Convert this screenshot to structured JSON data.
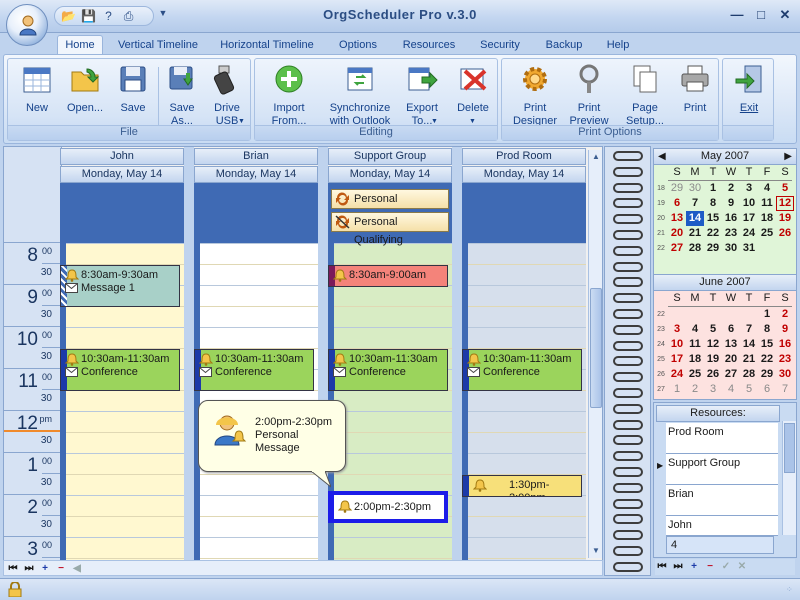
{
  "window": {
    "title": "OrgScheduler Pro v.3.0"
  },
  "menu_tabs": [
    "Home",
    "Vertical Timeline",
    "Horizontal Timeline",
    "Options",
    "Resources",
    "Security",
    "Backup",
    "Help"
  ],
  "ribbon": {
    "file": {
      "caption": "File",
      "buttons": [
        "New",
        "Open...",
        "Save",
        "Save\nAs...",
        "Drive\nUSB"
      ]
    },
    "editing": {
      "caption": "Editing",
      "buttons": [
        "Import\nFrom...",
        "Synchronize\nwith Outlook",
        "Export\nTo...",
        "Delete"
      ]
    },
    "print": {
      "caption": "Print Options",
      "buttons": [
        "Print\nDesigner",
        "Print\nPreview",
        "Page\nSetup...",
        "Print"
      ]
    },
    "exit": {
      "label": "Exit"
    }
  },
  "time_rows": [
    {
      "hour": "8",
      "mm": "00",
      "half": "30"
    },
    {
      "hour": "9",
      "mm": "00",
      "half": "30"
    },
    {
      "hour": "10",
      "mm": "00",
      "half": "30"
    },
    {
      "hour": "11",
      "mm": "00",
      "half": "30"
    },
    {
      "hour": "12",
      "mm": "pm",
      "half": "30"
    },
    {
      "hour": "1",
      "mm": "00",
      "half": "30"
    },
    {
      "hour": "2",
      "mm": "00",
      "half": "30"
    },
    {
      "hour": "3",
      "mm": "00",
      "half": ""
    }
  ],
  "columns": [
    {
      "name": "John",
      "date": "Monday, May 14"
    },
    {
      "name": "Brian",
      "date": "Monday, May 14"
    },
    {
      "name": "Support Group",
      "date": "Monday, May 14"
    },
    {
      "name": "Prod Room",
      "date": "Monday, May 14"
    }
  ],
  "allday": [
    {
      "label": "Personal Qualifying"
    },
    {
      "label": "Personal Qualifying"
    }
  ],
  "appointments": {
    "john1": {
      "time": "8:30am-9:30am",
      "subject": "Message 1"
    },
    "john2": {
      "time": "10:30am-11:30am",
      "subject": "Conference"
    },
    "brian1": {
      "time": "10:30am-11:30am",
      "subject": "Conference"
    },
    "support1": {
      "time": "8:30am-9:00am"
    },
    "support2": {
      "time": "10:30am-11:30am",
      "subject": "Conference"
    },
    "support3": {
      "time": "2:00pm-2:30pm"
    },
    "prod1": {
      "time": "10:30am-11:30am",
      "subject": "Conference"
    },
    "prod2": {
      "time": "1:30pm-2:00pm"
    }
  },
  "tooltip": {
    "time": "2:00pm-2:30pm",
    "line1": "Personal",
    "line2": "Message"
  },
  "mini_calendars": [
    {
      "title": "May 2007",
      "dow": [
        "S",
        "M",
        "T",
        "W",
        "T",
        "F",
        "S"
      ],
      "weeks": [
        {
          "wk": "18",
          "days": [
            "29",
            "30",
            "1",
            "2",
            "3",
            "4",
            "5"
          ]
        },
        {
          "wk": "19",
          "days": [
            "6",
            "7",
            "8",
            "9",
            "10",
            "11",
            "12"
          ]
        },
        {
          "wk": "20",
          "days": [
            "13",
            "14",
            "15",
            "16",
            "17",
            "18",
            "19"
          ]
        },
        {
          "wk": "21",
          "days": [
            "20",
            "21",
            "22",
            "23",
            "24",
            "25",
            "26"
          ]
        },
        {
          "wk": "22",
          "days": [
            "27",
            "28",
            "29",
            "30",
            "31",
            "",
            ""
          ]
        }
      ]
    },
    {
      "title": "June 2007",
      "dow": [
        "S",
        "M",
        "T",
        "W",
        "T",
        "F",
        "S"
      ],
      "weeks": [
        {
          "wk": "22",
          "days": [
            "",
            "",
            "",
            "",
            "",
            "1",
            "2"
          ]
        },
        {
          "wk": "23",
          "days": [
            "3",
            "4",
            "5",
            "6",
            "7",
            "8",
            "9"
          ]
        },
        {
          "wk": "24",
          "days": [
            "10",
            "11",
            "12",
            "13",
            "14",
            "15",
            "16"
          ]
        },
        {
          "wk": "25",
          "days": [
            "17",
            "18",
            "19",
            "20",
            "21",
            "22",
            "23"
          ]
        },
        {
          "wk": "26",
          "days": [
            "24",
            "25",
            "26",
            "27",
            "28",
            "29",
            "30"
          ]
        },
        {
          "wk": "27",
          "days": [
            "1",
            "2",
            "3",
            "4",
            "5",
            "6",
            "7"
          ]
        }
      ]
    }
  ],
  "resources": {
    "title": "Resources:",
    "items": [
      "Prod Room",
      "Support Group",
      "Brian",
      "John"
    ],
    "count": "4"
  },
  "colors": {
    "accent": "#3f6ab4",
    "today": "#1e5bc6",
    "weekend": "#c00000"
  }
}
